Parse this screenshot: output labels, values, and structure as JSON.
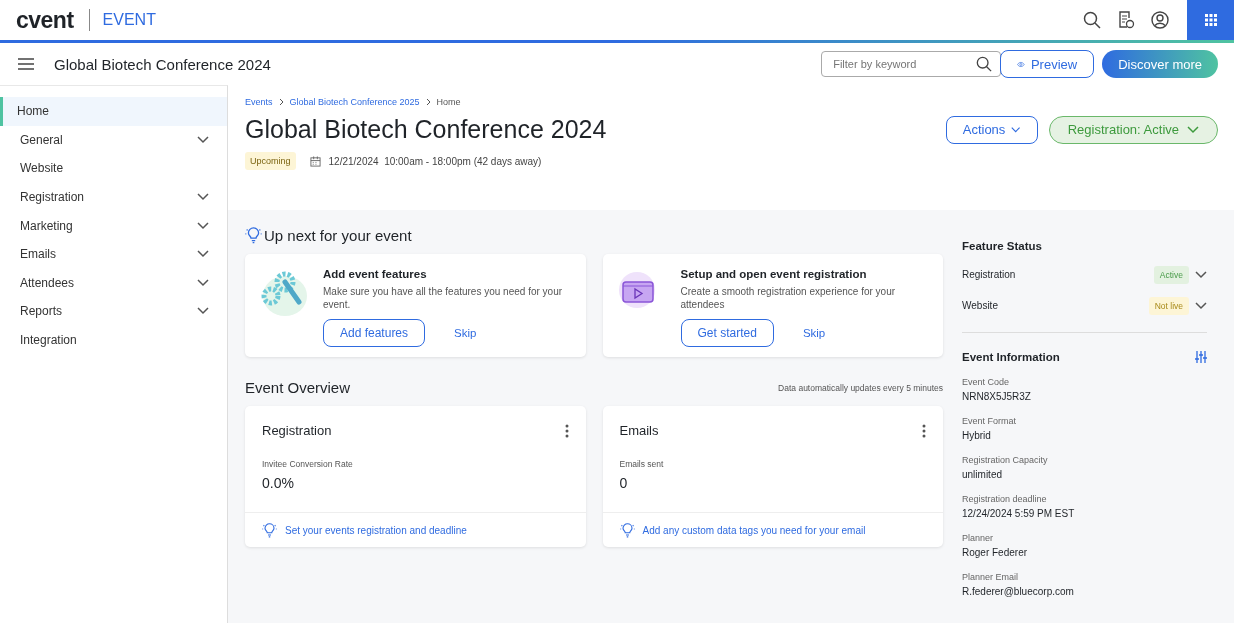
{
  "topbar": {
    "logo": "cvent",
    "product": "EVENT"
  },
  "subbar": {
    "title": "Global Biotech Conference 2024",
    "filter": {
      "placeholder": "Filter by keyword"
    },
    "preview": "Preview",
    "discover": "Discover more"
  },
  "sidebar": {
    "items": [
      {
        "label": "Home",
        "selected": true,
        "kind": "link"
      },
      {
        "label": "General",
        "selected": false,
        "kind": "group"
      },
      {
        "label": "Website",
        "selected": false,
        "kind": "link"
      },
      {
        "label": "Registration",
        "selected": false,
        "kind": "group"
      },
      {
        "label": "Marketing",
        "selected": false,
        "kind": "group"
      },
      {
        "label": "Emails",
        "selected": false,
        "kind": "group"
      },
      {
        "label": "Attendees",
        "selected": false,
        "kind": "group"
      },
      {
        "label": "Reports",
        "selected": false,
        "kind": "group"
      },
      {
        "label": "Integration",
        "selected": false,
        "kind": "link"
      }
    ]
  },
  "header": {
    "breadcrumbs": [
      {
        "label": "Events",
        "kind": "link"
      },
      {
        "label": "Global Biotech Conference 2025",
        "kind": "link"
      },
      {
        "label": "Home",
        "kind": "current"
      }
    ],
    "title": "Global Biotech Conference 2024",
    "status_badge": "Upcoming",
    "date": "12/21/2024  10:00am - 18:00pm (42 days away)",
    "actions": "Actions",
    "registration_status": "Registration: Active"
  },
  "up_next": {
    "title": "Up next for your event",
    "cards": [
      {
        "kind": "features",
        "title": "Add event features",
        "text": "Make sure you have all the features you need for your event.",
        "button": "Add features",
        "skip": "Skip"
      },
      {
        "kind": "registration",
        "title": "Setup and open event registration",
        "text": "Create a smooth registration experience for your attendees",
        "button": "Get started",
        "skip": "Skip"
      }
    ]
  },
  "overview": {
    "title": "Event Overview",
    "note": "Data automatically updates every 5 minutes",
    "cards": [
      {
        "title": "Registration",
        "metric_label": "Invitee Conversion Rate",
        "metric": "0.0%",
        "tip": "Set your events registration and deadline"
      },
      {
        "title": "Emails",
        "metric_label": "Emails sent",
        "metric": "0",
        "tip": "Add any custom data tags you need for your email"
      }
    ]
  },
  "feature_status": {
    "title": "Feature Status",
    "items": [
      {
        "label": "Registration",
        "status": "Active",
        "kind": "active"
      },
      {
        "label": "Website",
        "status": "Not live",
        "kind": "notlive"
      }
    ]
  },
  "event_information": {
    "title": "Event Information",
    "fields": [
      {
        "label": "Event Code",
        "value": "NRN8X5J5R3Z"
      },
      {
        "label": "Event Format",
        "value": "Hybrid"
      },
      {
        "label": "Registration Capacity",
        "value": "unlimited"
      },
      {
        "label": "Registration deadline",
        "value": "12/24/2024 5:59 PM EST"
      },
      {
        "label": "Planner",
        "value": "Roger Federer"
      },
      {
        "label": "Planner Email",
        "value": "R.federer@bluecorp.com"
      }
    ]
  }
}
